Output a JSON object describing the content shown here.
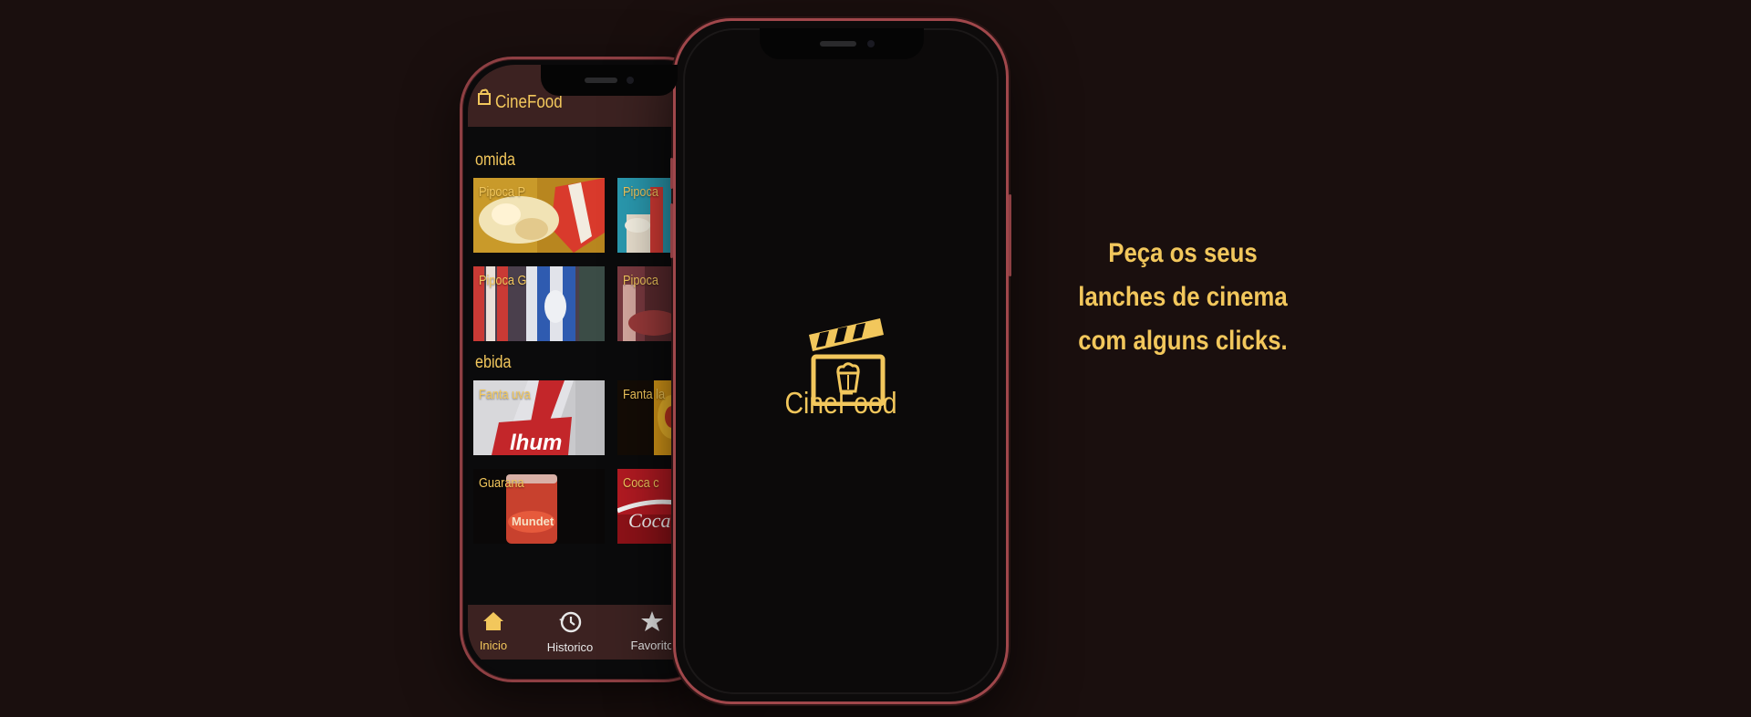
{
  "app": {
    "name": "CineFood"
  },
  "home_screen": {
    "header_title": "CineFood",
    "sections": [
      {
        "title": "omida",
        "items": [
          {
            "label": "Pipoca P"
          },
          {
            "label": "Pipoca"
          },
          {
            "label": "Pipoca G"
          },
          {
            "label": "Pipoca"
          }
        ]
      },
      {
        "title": "ebida",
        "items": [
          {
            "label": "Fanta uva"
          },
          {
            "label": "Fanta la"
          },
          {
            "label": "Guarana"
          },
          {
            "label": "Coca c"
          }
        ]
      }
    ],
    "bottom_nav": [
      {
        "label": "Inicio",
        "icon": "home-icon",
        "active": true
      },
      {
        "label": "Historico",
        "icon": "history-icon",
        "active": false
      },
      {
        "label": "Favorito",
        "icon": "star-icon",
        "active": false
      }
    ]
  },
  "splash_screen": {
    "app_name": "CineFood",
    "logo_icon": "clapperboard-popcorn-icon"
  },
  "tagline": {
    "line1": "Peça os seus",
    "line2": "lanches de cinema",
    "line3": "com alguns clicks."
  },
  "colors": {
    "background": "#1a0f0e",
    "accent": "#f2c75c",
    "header": "#3c2221",
    "phone_frame": "#a0474b"
  }
}
